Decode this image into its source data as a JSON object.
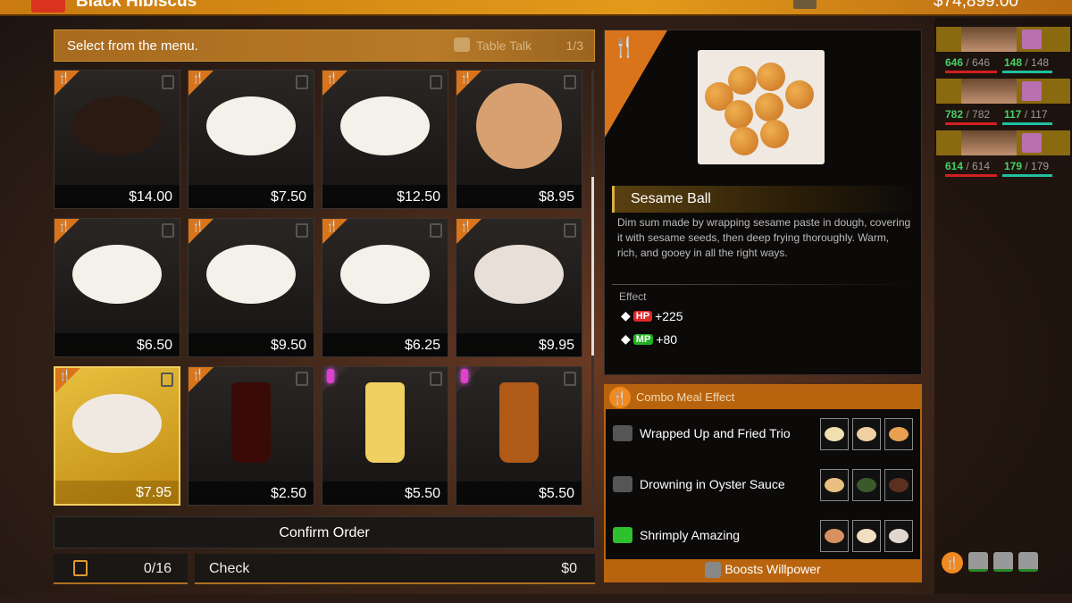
{
  "topbar": {
    "title": "Black Hibiscus",
    "money": "$74,899.00"
  },
  "header": {
    "prompt": "Select from the menu.",
    "table_talk": "Table Talk",
    "page": "1/3"
  },
  "menu": [
    {
      "price": "$14.00",
      "type": "food",
      "plate": "#2a1a12"
    },
    {
      "price": "$7.50",
      "type": "food",
      "plate": "#f4f0ea"
    },
    {
      "price": "$12.50",
      "type": "food",
      "plate": "#f4f0ea"
    },
    {
      "price": "$8.95",
      "type": "food",
      "plate": "#d8a070"
    },
    {
      "price": "$6.50",
      "type": "food",
      "plate": "#f4f0ea"
    },
    {
      "price": "$9.50",
      "type": "food",
      "plate": "#f4f0ea"
    },
    {
      "price": "$6.25",
      "type": "food",
      "plate": "#f4f0ea"
    },
    {
      "price": "$9.95",
      "type": "food",
      "plate": "#e8e0d8"
    },
    {
      "price": "$7.95",
      "type": "food",
      "plate": "#efe9e2",
      "selected": true
    },
    {
      "price": "$2.50",
      "type": "drink",
      "plate": "#3a0a06"
    },
    {
      "price": "$5.50",
      "type": "drink",
      "plate": "#f0d060"
    },
    {
      "price": "$5.50",
      "type": "drink",
      "plate": "#b05a18"
    }
  ],
  "order": {
    "confirm": "Confirm Order",
    "count": "0/16",
    "check_label": "Check",
    "check_value": "$0"
  },
  "detail": {
    "name": "Sesame Ball",
    "description": "Dim sum made by wrapping sesame paste in dough, covering it with sesame seeds, then deep frying thoroughly. Warm, rich, and gooey in all the right ways.",
    "effect_label": "Effect",
    "effects": [
      {
        "stat": "HP",
        "value": "+225",
        "color": "#e02828"
      },
      {
        "stat": "MP",
        "value": "+80",
        "color": "#20b020"
      }
    ]
  },
  "combo": {
    "title": "Combo Meal Effect",
    "items": [
      {
        "name": "Wrapped Up and Fried Trio",
        "achieved": false
      },
      {
        "name": "Drowning in Oyster Sauce",
        "achieved": false
      },
      {
        "name": "Shrimply Amazing",
        "achieved": true
      }
    ],
    "footer": "Boosts Willpower"
  },
  "party": [
    {
      "hp": "646",
      "hp_max": "/ 646",
      "mp": "148",
      "mp_max": "/ 148"
    },
    {
      "hp": "782",
      "hp_max": "/ 782",
      "mp": "117",
      "mp_max": "/ 117"
    },
    {
      "hp": "614",
      "hp_max": "/ 614",
      "mp": "179",
      "mp_max": "/ 179"
    }
  ]
}
